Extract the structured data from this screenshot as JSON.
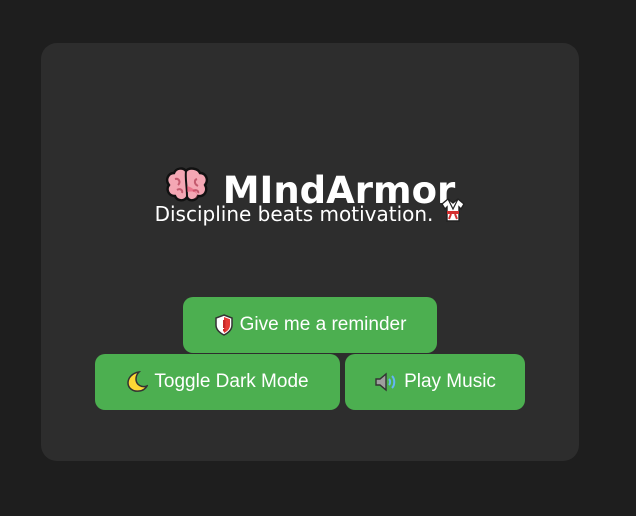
{
  "app": {
    "title": "MIndArmor",
    "subtitle": "Discipline beats motivation.",
    "title_icon": "brain-icon",
    "subtitle_icon": "martial-arts-uniform-icon"
  },
  "buttons": {
    "reminder": {
      "label": "Give me a reminder",
      "icon": "shield-icon"
    },
    "dark_mode": {
      "label": "Toggle Dark Mode",
      "icon": "crescent-moon-icon"
    },
    "music": {
      "label": "Play Music",
      "icon": "speaker-icon"
    }
  },
  "colors": {
    "background": "#1e1e1e",
    "card": "#2d2d2d",
    "button": "#4caf50",
    "text": "#ffffff"
  }
}
